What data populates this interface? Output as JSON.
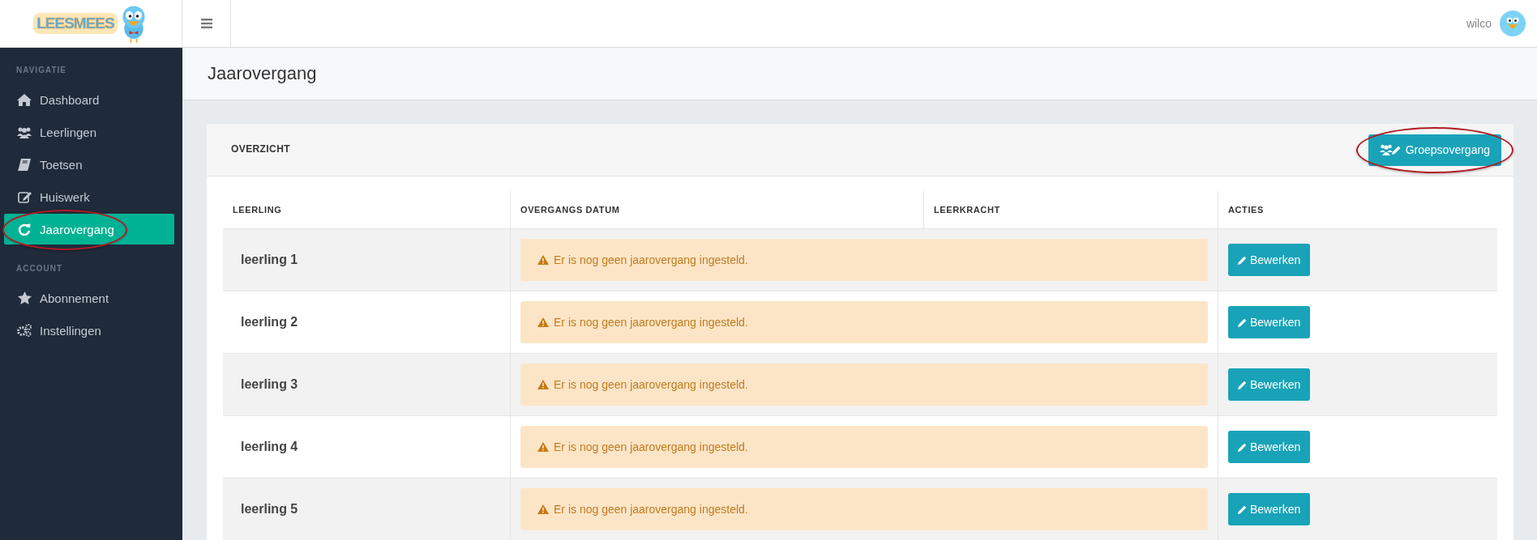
{
  "logo": {
    "text": "LEESMEES"
  },
  "topbar": {
    "user": "wilco"
  },
  "sidebar": {
    "sections": [
      {
        "heading": "NAVIGATIE",
        "items": [
          {
            "label": "Dashboard",
            "kind": "home",
            "selected": false,
            "circled": false
          },
          {
            "label": "Leerlingen",
            "kind": "users",
            "selected": false,
            "circled": false
          },
          {
            "label": "Toetsen",
            "kind": "book",
            "selected": false,
            "circled": false
          },
          {
            "label": "Huiswerk",
            "kind": "edit",
            "selected": false,
            "circled": false
          },
          {
            "label": "Jaarovergang",
            "kind": "refresh",
            "selected": true,
            "circled": true
          }
        ]
      },
      {
        "heading": "ACCOUNT",
        "items": [
          {
            "label": "Abonnement",
            "kind": "star",
            "selected": false,
            "circled": false
          },
          {
            "label": "Instellingen",
            "kind": "gears",
            "selected": false,
            "circled": false
          }
        ]
      }
    ]
  },
  "page": {
    "title": "Jaarovergang"
  },
  "card": {
    "title": "OVERZICHT",
    "action": {
      "label": "Groepsovergang",
      "circled": true
    }
  },
  "table": {
    "columns": [
      "LEERLING",
      "OVERGANGS DATUM",
      "LEERKRACHT",
      "ACTIES"
    ],
    "rows": [
      {
        "student": "leerling 1",
        "notice": "Er is nog geen jaarovergang ingesteld.",
        "action": "Bewerken"
      },
      {
        "student": "leerling 2",
        "notice": "Er is nog geen jaarovergang ingesteld.",
        "action": "Bewerken"
      },
      {
        "student": "leerling 3",
        "notice": "Er is nog geen jaarovergang ingesteld.",
        "action": "Bewerken"
      },
      {
        "student": "leerling 4",
        "notice": "Er is nog geen jaarovergang ingesteld.",
        "action": "Bewerken"
      },
      {
        "student": "leerling 5",
        "notice": "Er is nog geen jaarovergang ingesteld.",
        "action": "Bewerken"
      }
    ]
  }
}
